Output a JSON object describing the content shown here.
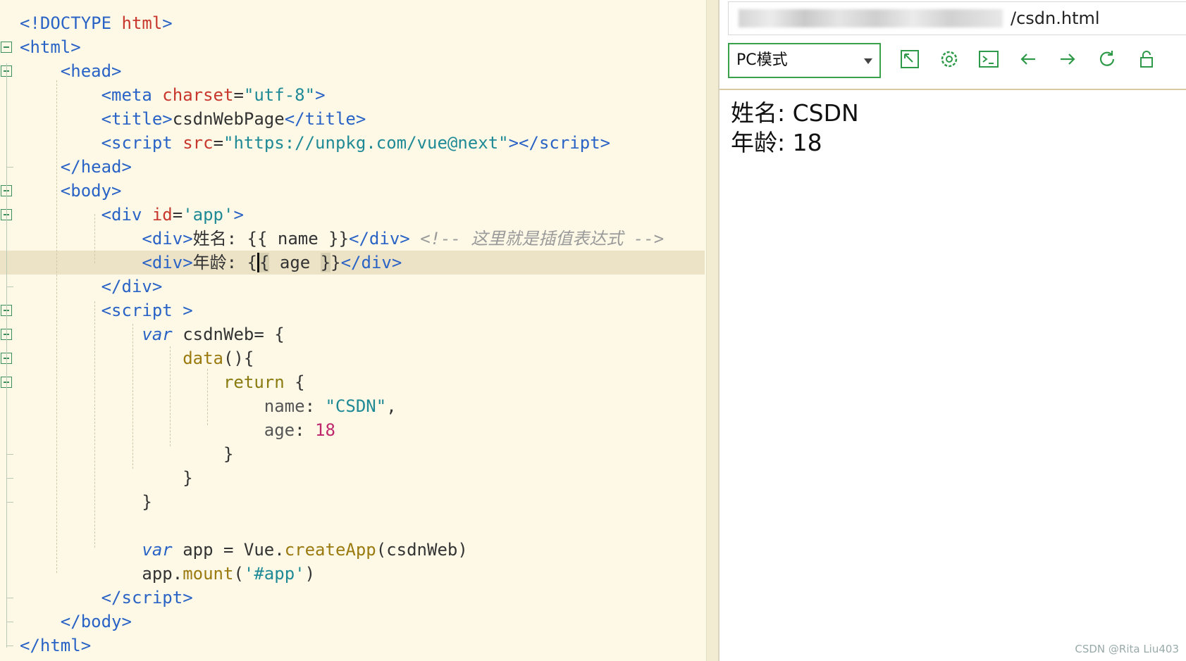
{
  "editor": {
    "lines": [
      {
        "fold": false,
        "html": "<span class=\"tag\">&lt;!DOCTYPE</span> <span class=\"attr\">html</span><span class=\"tag\">&gt;</span>"
      },
      {
        "fold": true,
        "html": "<span class=\"tag\">&lt;html&gt;</span>"
      },
      {
        "fold": true,
        "html": "    <span class=\"tag\">&lt;head&gt;</span>"
      },
      {
        "fold": false,
        "html": "        <span class=\"tag\">&lt;meta</span> <span class=\"attr\">charset</span>=<span class=\"str\">\"utf-8\"</span><span class=\"tag\">&gt;</span>"
      },
      {
        "fold": false,
        "html": "        <span class=\"tag\">&lt;title&gt;</span>csdnWebPage<span class=\"tag\">&lt;/title&gt;</span>"
      },
      {
        "fold": false,
        "html": "        <span class=\"tag\">&lt;script</span> <span class=\"attr\">src</span>=<span class=\"str\">\"https://unpkg.com/vue@next\"</span><span class=\"tag\">&gt;&lt;/script&gt;</span>"
      },
      {
        "fold": false,
        "html": "    <span class=\"tag\">&lt;/head&gt;</span>"
      },
      {
        "fold": true,
        "html": "    <span class=\"tag\">&lt;body&gt;</span>"
      },
      {
        "fold": true,
        "html": "        <span class=\"tag\">&lt;div</span> <span class=\"attr\">id</span>=<span class=\"str\">'app'</span><span class=\"tag\">&gt;</span>"
      },
      {
        "fold": false,
        "html": "            <span class=\"tag\">&lt;div&gt;</span>姓名: {{ name }}<span class=\"tag\">&lt;/div&gt;</span> <span class=\"cmt\">&lt;!-- 这里就是插值表达式 --&gt;</span>"
      },
      {
        "fold": false,
        "hl": true,
        "html": "            <span class=\"tag\">&lt;div&gt;</span>年龄: {<span class=\"brk caret\">{</span> age <span class=\"brk\">}</span>}<span class=\"tag\">&lt;/div&gt;</span>"
      },
      {
        "fold": false,
        "html": "        <span class=\"tag\">&lt;/div&gt;</span>"
      },
      {
        "fold": true,
        "html": "        <span class=\"tag\">&lt;script</span> <span class=\"tag\">&gt;</span>"
      },
      {
        "fold": true,
        "html": "            <span class=\"kw\">var</span> csdnWeb= {"
      },
      {
        "fold": true,
        "html": "                <span class=\"fn\">data</span>(){"
      },
      {
        "fold": true,
        "html": "                    <span class=\"ret\">return</span> {"
      },
      {
        "fold": false,
        "html": "                        <span class=\"prop\">name</span>: <span class=\"str\">\"CSDN\"</span>,"
      },
      {
        "fold": false,
        "html": "                        <span class=\"prop\">age</span>: <span class=\"num\">18</span>"
      },
      {
        "fold": false,
        "html": "                    }"
      },
      {
        "fold": false,
        "html": "                }"
      },
      {
        "fold": false,
        "html": "            }"
      },
      {
        "fold": false,
        "html": ""
      },
      {
        "fold": false,
        "html": "            <span class=\"kw\">var</span> app = Vue.<span class=\"fn\">createApp</span>(csdnWeb)"
      },
      {
        "fold": false,
        "html": "            app.<span class=\"fn\">mount</span>(<span class=\"str\">'#app'</span>)"
      },
      {
        "fold": false,
        "html": "        <span class=\"tag\">&lt;/script&gt;</span>"
      },
      {
        "fold": false,
        "html": "    <span class=\"tag\">&lt;/body&gt;</span>"
      },
      {
        "fold": false,
        "html": "<span class=\"tag\">&lt;/html&gt;</span>"
      }
    ]
  },
  "browser": {
    "url_visible": "/csdn.html",
    "mode_label": "PC模式",
    "toolbar_icons": [
      "expand-icon",
      "settings-icon",
      "console-icon",
      "back-arrow-icon",
      "forward-arrow-icon",
      "refresh-icon",
      "lock-icon"
    ],
    "page": {
      "name_line": "姓名: CSDN",
      "age_line": "年龄: 18"
    }
  },
  "watermark": "CSDN @Rita Liu403",
  "colors": {
    "accent": "#3aa14b",
    "tag": "#2a63c6",
    "attr": "#c8372d",
    "string": "#1f8a96"
  }
}
